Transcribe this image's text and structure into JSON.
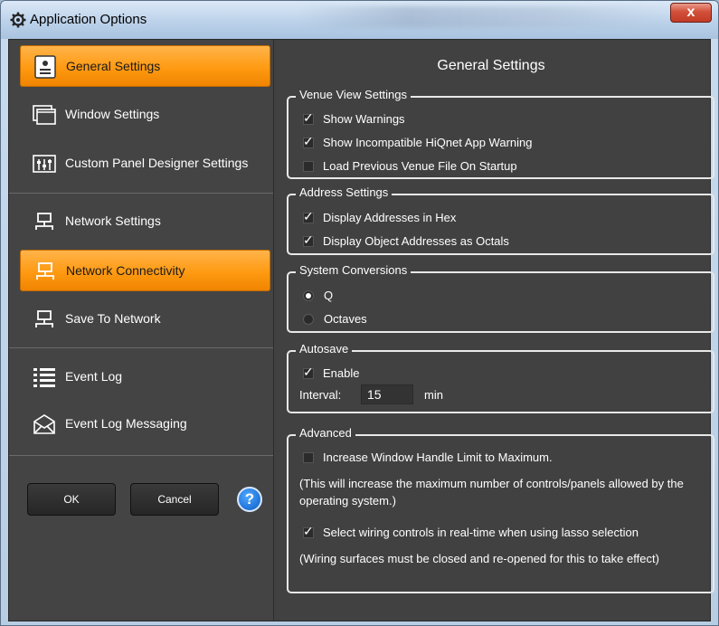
{
  "window": {
    "title": "Application Options",
    "close_label": "x"
  },
  "sidebar": {
    "items": [
      {
        "label": "General Settings",
        "icon": "general-settings-icon",
        "selected": true
      },
      {
        "label": "Window Settings",
        "icon": "window-icon",
        "selected": false
      },
      {
        "label": "Custom Panel Designer Settings",
        "icon": "panel-designer-icon",
        "selected": false
      },
      {
        "label": "Network Settings",
        "icon": "network-icon",
        "selected": false
      },
      {
        "label": "Network Connectivity",
        "icon": "network-connectivity-icon",
        "selected": true
      },
      {
        "label": "Save To Network",
        "icon": "save-network-icon",
        "selected": false
      },
      {
        "label": "Event Log",
        "icon": "event-log-icon",
        "selected": false
      },
      {
        "label": "Event Log Messaging",
        "icon": "envelope-icon",
        "selected": false
      }
    ],
    "ok_label": "OK",
    "cancel_label": "Cancel",
    "help_label": "?"
  },
  "main": {
    "title": "General Settings",
    "venue": {
      "title": "Venue View Settings",
      "options": [
        {
          "label": "Show Warnings",
          "checked": true
        },
        {
          "label": "Show Incompatible HiQnet App Warning",
          "checked": true
        },
        {
          "label": "Load Previous Venue File On Startup",
          "checked": false
        }
      ]
    },
    "address": {
      "title": "Address Settings",
      "options": [
        {
          "label": "Display Addresses in Hex",
          "checked": true
        },
        {
          "label": "Display Object Addresses as Octals",
          "checked": true
        }
      ]
    },
    "conversions": {
      "title": "System Conversions",
      "options": [
        {
          "label": "Q",
          "selected": true
        },
        {
          "label": "Octaves",
          "selected": false
        }
      ]
    },
    "autosave": {
      "title": "Autosave",
      "enable_label": "Enable",
      "enable_checked": true,
      "interval_label": "Interval:",
      "interval_value": "15",
      "interval_unit": "min"
    },
    "advanced": {
      "title": "Advanced",
      "handle_limit_label": "Increase Window Handle Limit to Maximum.",
      "handle_limit_checked": false,
      "handle_limit_note": "(This will increase the maximum number of controls/panels allowed by the operating system.)",
      "lasso_label": "Select wiring controls in real-time when using lasso selection",
      "lasso_checked": true,
      "lasso_note": "(Wiring surfaces must be closed and re-opened for this to take effect)"
    }
  },
  "colors": {
    "accent": "#ff9a12",
    "panel": "#414141",
    "sidebar": "#444444"
  }
}
